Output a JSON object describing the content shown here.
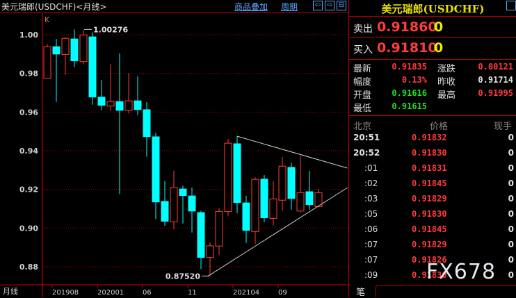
{
  "header": {
    "title": "美元瑞郎(USDCHF)<月线>",
    "overlay_link": "商品叠加",
    "period_link": "周期"
  },
  "chart": {
    "indicator_label": "K",
    "y_ticks": [
      "1.00",
      "0.98",
      "0.96",
      "0.94",
      "0.92",
      "0.90",
      "0.88"
    ],
    "x_axis_label": "月线",
    "x_ticks": [
      {
        "i": 1,
        "label": "201908"
      },
      {
        "i": 6,
        "label": "202001"
      },
      {
        "i": 11,
        "label": "06"
      },
      {
        "i": 16,
        "label": "11"
      },
      {
        "i": 21,
        "label": "202104"
      },
      {
        "i": 26,
        "label": "09"
      }
    ],
    "high_annotation": {
      "i": 4,
      "price": 1.00276,
      "label": "1.00276"
    },
    "low_annotation": {
      "i": 18,
      "price": 0.8752,
      "label": "0.87520"
    },
    "ylim": [
      0.8705,
      1.0108
    ],
    "up_color": "#ff3b3b",
    "down_color": "#00ffff",
    "trendlines": [
      {
        "from": [
          21,
          0.9475
        ],
        "to": [
          33.2,
          0.931
        ]
      },
      {
        "from": [
          17.8,
          0.8752
        ],
        "to": [
          33.2,
          0.9209
        ]
      }
    ],
    "candles": [
      [
        0.9774,
        0.9952,
        0.9774,
        0.9938
      ],
      [
        0.9938,
        0.9978,
        0.9653,
        0.99
      ],
      [
        0.9898,
        0.9988,
        0.9793,
        0.9981
      ],
      [
        0.9978,
        1.00276,
        0.9832,
        0.9865
      ],
      [
        0.9861,
        1.0024,
        0.9847,
        0.9999
      ],
      [
        0.9989,
        1.0012,
        0.9638,
        0.9678
      ],
      [
        0.9677,
        0.9766,
        0.9609,
        0.9635
      ],
      [
        0.9631,
        0.9849,
        0.9606,
        0.9654
      ],
      [
        0.9654,
        0.9903,
        0.9175,
        0.9609
      ],
      [
        0.9609,
        0.9802,
        0.9593,
        0.9658
      ],
      [
        0.9658,
        0.9784,
        0.9584,
        0.9613
      ],
      [
        0.9612,
        0.9651,
        0.9369,
        0.9473
      ],
      [
        0.9472,
        0.9493,
        0.9048,
        0.9135
      ],
      [
        0.9138,
        0.9243,
        0.9012,
        0.9035
      ],
      [
        0.9032,
        0.9296,
        0.8994,
        0.921
      ],
      [
        0.9202,
        0.922,
        0.9023,
        0.9168
      ],
      [
        0.9166,
        0.921,
        0.8977,
        0.9088
      ],
      [
        0.908,
        0.909,
        0.8788,
        0.8848
      ],
      [
        0.8848,
        0.8925,
        0.8752,
        0.8908
      ],
      [
        0.8907,
        0.9102,
        0.8862,
        0.9086
      ],
      [
        0.9086,
        0.9461,
        0.9063,
        0.9439
      ],
      [
        0.9436,
        0.9475,
        0.9076,
        0.9132
      ],
      [
        0.913,
        0.9166,
        0.8922,
        0.8988
      ],
      [
        0.8982,
        0.9263,
        0.8919,
        0.9252
      ],
      [
        0.9253,
        0.9274,
        0.903,
        0.9053
      ],
      [
        0.905,
        0.9242,
        0.9013,
        0.9151
      ],
      [
        0.9144,
        0.9368,
        0.909,
        0.932
      ],
      [
        0.9314,
        0.9339,
        0.9095,
        0.9153
      ],
      [
        0.9088,
        0.9374,
        0.9081,
        0.9183
      ],
      [
        0.9188,
        0.9296,
        0.9095,
        0.9121
      ],
      [
        0.9111,
        0.9202,
        0.9106,
        0.9183
      ]
    ]
  },
  "quote": {
    "title": "美元瑞郎(USDCHF)",
    "sell_label": "卖出",
    "sell_price": "0.91860",
    "sell_qty": "0",
    "buy_label": "买入",
    "buy_price": "0.91810",
    "buy_qty": "0",
    "stats": [
      {
        "label": "最新",
        "value": "0.91835",
        "color": "#ff3b3b"
      },
      {
        "label": "涨跌",
        "value": "0.00121",
        "color": "#ff3b3b"
      },
      {
        "label": "幅度",
        "value": "0.13%",
        "color": "#ff3b3b"
      },
      {
        "label": "昨收",
        "value": "0.91714",
        "color": "#e0e0e0"
      },
      {
        "label": "开盘",
        "value": "0.91616",
        "color": "#22e022"
      },
      {
        "label": "最高",
        "value": "0.91995",
        "color": "#ff3b3b"
      },
      {
        "label": "最低",
        "value": "0.91615",
        "color": "#22e022"
      }
    ],
    "ticks_header": {
      "time": "北京",
      "price": "价格",
      "qty": "现手"
    },
    "ticks": [
      {
        "time": "20:51",
        "price": "0.91832",
        "qty": "0"
      },
      {
        "time": "20:52",
        "price": "0.91830",
        "qty": "0"
      },
      {
        "time": ":01",
        "price": "0.91831",
        "qty": "0"
      },
      {
        "time": ":02",
        "price": "0.91845",
        "qty": "0"
      },
      {
        "time": ":03",
        "price": "0.91829",
        "qty": "0"
      },
      {
        "time": ":05",
        "price": "0.91830",
        "qty": "0"
      },
      {
        "time": ":06",
        "price": "0.91845",
        "qty": "0"
      },
      {
        "time": ":07",
        "price": "0.91829",
        "qty": "0"
      },
      {
        "time": ":07",
        "price": "0.91826",
        "qty": "0"
      },
      {
        "time": ":09",
        "price": "0.91830",
        "qty": "0"
      }
    ],
    "tab_label": "笔"
  },
  "watermark": "FX678"
}
